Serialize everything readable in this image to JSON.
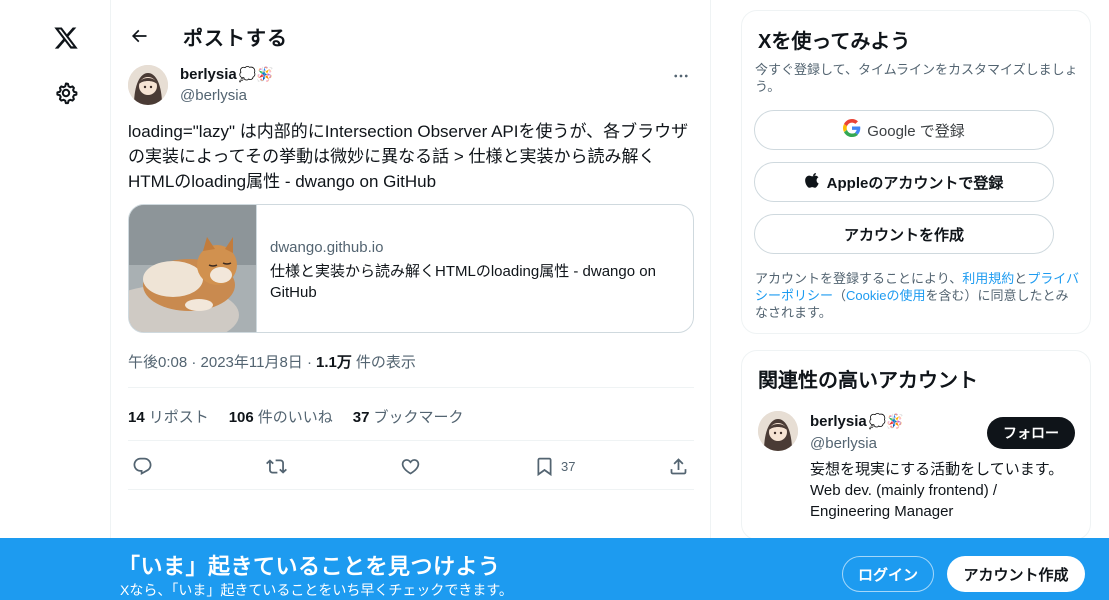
{
  "colors": {
    "accent": "#1d9bf0",
    "text": "#0f1419",
    "muted": "#536471",
    "border": "#cfd9de"
  },
  "nav": {
    "logo_icon": "x-logo-icon",
    "settings_icon": "gear-icon"
  },
  "header": {
    "title": "ポストする",
    "back_icon": "arrow-left-icon"
  },
  "tweet": {
    "author_name": "berlysia",
    "author_emoji": "💭🪅",
    "author_handle": "@berlysia",
    "text": "loading=\"lazy\" は内部的にIntersection Observer APIを使うが、各ブラウザの実装によってその挙動は微妙に異なる話 > 仕様と実装から読み解くHTMLのloading属性 - dwango on GitHub",
    "card": {
      "domain": "dwango.github.io",
      "title": "仕様と実装から読み解くHTMLのloading属性 - dwango on GitHub"
    },
    "time": "午後0:08 · 2023年11月8日 ·",
    "views_count": "1.1万",
    "views_label": "件の表示",
    "reposts_count": "14",
    "reposts_label": "リポスト",
    "likes_count": "106",
    "likes_label": "件のいいね",
    "bookmarks_count": "37",
    "bookmarks_label": "ブックマーク",
    "bookmark_action_count": "37"
  },
  "signup_panel": {
    "title": "Xを使ってみよう",
    "subtitle": "今すぐ登録して、タイムラインをカスタマイズしましょう。",
    "google_label": "Google で登録",
    "apple_label": "Appleのアカウントで登録",
    "create_label": "アカウントを作成",
    "terms_pre": "アカウントを登録することにより、",
    "terms_link": "利用規約",
    "terms_and": "と",
    "privacy_link": "プライバシーポリシー",
    "cookie_open": "（",
    "cookie_link": "Cookieの使用",
    "terms_post": "を含む）に同意したとみなされます。"
  },
  "related": {
    "title": "関連性の高いアカウント",
    "name": "berlysia",
    "emoji": "💭🪅",
    "handle": "@berlysia",
    "follow_label": "フォロー",
    "bio": "妄想を現実にする活動をしています。Web dev. (mainly frontend) / Engineering Manager"
  },
  "banner": {
    "title": "「いま」起きていることを見つけよう",
    "subtitle": "Xなら、「いま」起きていることをいち早くチェックできます。",
    "login_label": "ログイン",
    "signup_label": "アカウント作成"
  }
}
